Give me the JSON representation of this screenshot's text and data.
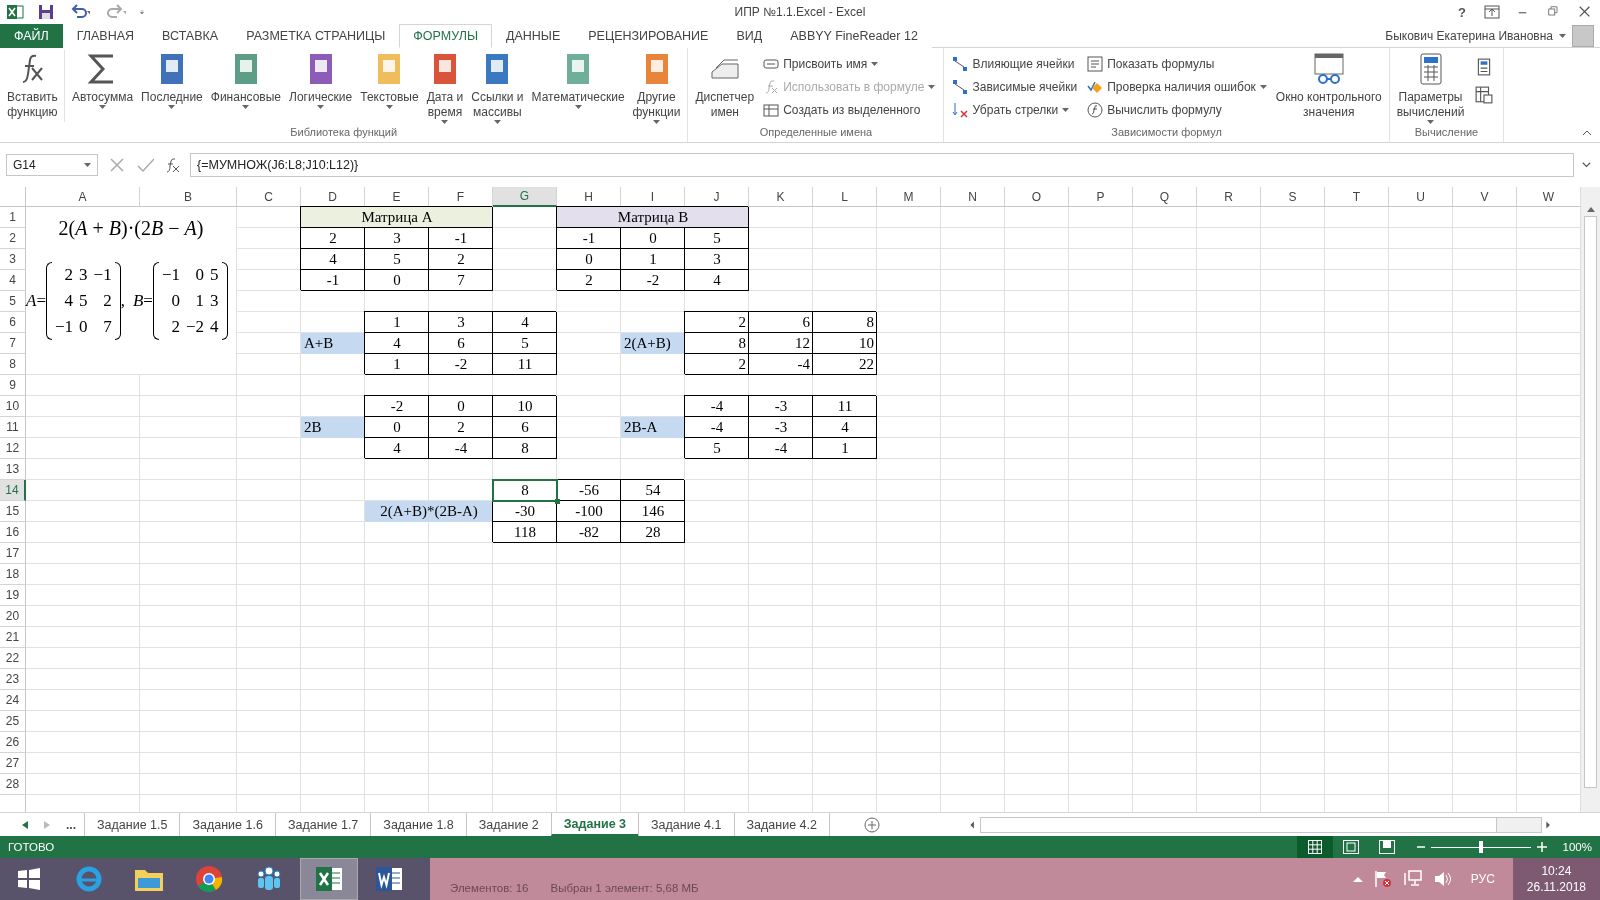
{
  "window": {
    "title": "ИПР №1.1.Excel - Excel",
    "help": "?"
  },
  "tabs": [
    {
      "label": "ФАЙЛ",
      "kind": "file",
      "selected": false
    },
    {
      "label": "ГЛАВНАЯ",
      "kind": "tab",
      "selected": false
    },
    {
      "label": "ВСТАВКА",
      "kind": "tab",
      "selected": false
    },
    {
      "label": "РАЗМЕТКА СТРАНИЦЫ",
      "kind": "tab",
      "selected": false
    },
    {
      "label": "ФОРМУЛЫ",
      "kind": "tab",
      "selected": true
    },
    {
      "label": "ДАННЫЕ",
      "kind": "tab",
      "selected": false
    },
    {
      "label": "РЕЦЕНЗИРОВАНИЕ",
      "kind": "tab",
      "selected": false
    },
    {
      "label": "ВИД",
      "kind": "tab",
      "selected": false
    },
    {
      "label": "ABBYY FineReader 12",
      "kind": "tab",
      "selected": false
    }
  ],
  "user": "Быкович Екатерина Ивановна",
  "ribbon": [
    {
      "label": "Библиотека функций",
      "items": [
        {
          "kind": "big",
          "lines": [
            "Вставить",
            "функцию"
          ],
          "menu": false
        },
        {
          "kind": "big",
          "lines": [
            "Автосумма"
          ],
          "menu": true
        },
        {
          "kind": "big",
          "lines": [
            "Последние"
          ],
          "menu": true
        },
        {
          "kind": "big",
          "lines": [
            "Финансовые"
          ],
          "menu": true
        },
        {
          "kind": "big",
          "lines": [
            "Логические"
          ],
          "menu": true
        },
        {
          "kind": "big",
          "lines": [
            "Текстовые"
          ],
          "menu": true
        },
        {
          "kind": "big",
          "lines": [
            "Дата и",
            "время"
          ],
          "menu": true
        },
        {
          "kind": "big",
          "lines": [
            "Ссылки и",
            "массивы"
          ],
          "menu": true
        },
        {
          "kind": "big",
          "lines": [
            "Математические"
          ],
          "menu": true
        },
        {
          "kind": "big",
          "lines": [
            "Другие",
            "функции"
          ],
          "menu": true
        }
      ]
    },
    {
      "label": "Определенные имена",
      "items": [
        {
          "kind": "big",
          "lines": [
            "Диспетчер",
            "имен"
          ],
          "menu": false
        },
        {
          "kind": "stack",
          "items": [
            {
              "label": "Присвоить имя",
              "menu": true,
              "disabled": false
            },
            {
              "label": "Использовать в формуле",
              "menu": true,
              "disabled": true
            },
            {
              "label": "Создать из выделенного",
              "menu": false,
              "disabled": false
            }
          ]
        }
      ]
    },
    {
      "label": "Зависимости формул",
      "items": [
        {
          "kind": "stack",
          "items": [
            {
              "label": "Влияющие ячейки",
              "menu": false,
              "disabled": false
            },
            {
              "label": "Зависимые ячейки",
              "menu": false,
              "disabled": false
            },
            {
              "label": "Убрать стрелки",
              "menu": true,
              "disabled": false
            }
          ]
        },
        {
          "kind": "stack",
          "items": [
            {
              "label": "Показать формулы",
              "menu": false,
              "disabled": false
            },
            {
              "label": "Проверка наличия ошибок",
              "menu": true,
              "disabled": false
            },
            {
              "label": "Вычислить формулу",
              "menu": false,
              "disabled": false
            }
          ]
        },
        {
          "kind": "big",
          "lines": [
            "Окно контрольного",
            "значения"
          ],
          "menu": false
        }
      ]
    },
    {
      "label": "Вычисление",
      "items": [
        {
          "kind": "big",
          "lines": [
            "Параметры",
            "вычислений"
          ],
          "menu": true
        },
        {
          "kind": "icons"
        }
      ]
    }
  ],
  "formula_bar": {
    "name_box": "G14",
    "formula": "{=МУМНОЖ(J6:L8;J10:L12)}"
  },
  "sheet": {
    "columns": [
      {
        "label": "A",
        "selected": false
      },
      {
        "label": "B",
        "selected": false
      },
      {
        "label": "C",
        "selected": false
      },
      {
        "label": "D",
        "selected": false
      },
      {
        "label": "E",
        "selected": false
      },
      {
        "label": "F",
        "selected": false
      },
      {
        "label": "G",
        "selected": true
      },
      {
        "label": "H",
        "selected": false
      },
      {
        "label": "I",
        "selected": false
      },
      {
        "label": "J",
        "selected": false
      },
      {
        "label": "K",
        "selected": false
      },
      {
        "label": "L",
        "selected": false
      },
      {
        "label": "M",
        "selected": false
      },
      {
        "label": "N",
        "selected": false
      },
      {
        "label": "O",
        "selected": false
      },
      {
        "label": "P",
        "selected": false
      },
      {
        "label": "Q",
        "selected": false
      },
      {
        "label": "R",
        "selected": false
      },
      {
        "label": "S",
        "selected": false
      },
      {
        "label": "T",
        "selected": false
      },
      {
        "label": "U",
        "selected": false
      },
      {
        "label": "V",
        "selected": false
      },
      {
        "label": "W",
        "selected": false
      }
    ],
    "rows": [
      {
        "label": "1",
        "selected": false,
        "cells": [
          "",
          "",
          "",
          {
            "value": "Матрица А",
            "kind": "title-a",
            "selected": false
          },
          "",
          "",
          "",
          {
            "value": "Матрица В",
            "kind": "title-b",
            "selected": false
          }
        ]
      },
      {
        "label": "2",
        "selected": false,
        "cells": [
          "",
          "",
          "",
          {
            "value": "2",
            "kind": "boxed",
            "selected": false
          },
          {
            "value": "3",
            "kind": "boxed",
            "selected": false
          },
          {
            "value": "-1",
            "kind": "boxed",
            "selected": false
          },
          "",
          {
            "value": "-1",
            "kind": "boxed",
            "selected": false
          },
          {
            "value": "0",
            "kind": "boxed",
            "selected": false
          },
          {
            "value": "5",
            "kind": "boxed",
            "selected": false
          }
        ]
      },
      {
        "label": "3",
        "selected": false,
        "cells": [
          "",
          "",
          "",
          {
            "value": "4",
            "kind": "boxed",
            "selected": false
          },
          {
            "value": "5",
            "kind": "boxed",
            "selected": false
          },
          {
            "value": "2",
            "kind": "boxed",
            "selected": false
          },
          "",
          {
            "value": "0",
            "kind": "boxed",
            "selected": false
          },
          {
            "value": "1",
            "kind": "boxed",
            "selected": false
          },
          {
            "value": "3",
            "kind": "boxed",
            "selected": false
          }
        ]
      },
      {
        "label": "4",
        "selected": false,
        "cells": [
          "",
          "",
          "",
          {
            "value": "-1",
            "kind": "boxed",
            "selected": false
          },
          {
            "value": "0",
            "kind": "boxed",
            "selected": false
          },
          {
            "value": "7",
            "kind": "boxed",
            "selected": false
          },
          "",
          {
            "value": "2",
            "kind": "boxed",
            "selected": false
          },
          {
            "value": "-2",
            "kind": "boxed",
            "selected": false
          },
          {
            "value": "4",
            "kind": "boxed",
            "selected": false
          }
        ]
      },
      {
        "label": "5",
        "selected": false
      },
      {
        "label": "6",
        "selected": false,
        "cells": [
          "",
          "",
          "",
          "",
          {
            "value": "1",
            "kind": "boxed",
            "selected": false
          },
          {
            "value": "3",
            "kind": "boxed",
            "selected": false
          },
          {
            "value": "4",
            "kind": "boxed",
            "selected": false
          },
          "",
          "",
          {
            "value": "2",
            "kind": "boxed-right",
            "selected": false
          },
          {
            "value": "6",
            "kind": "boxed-right",
            "selected": false
          },
          {
            "value": "8",
            "kind": "boxed-right",
            "selected": false
          }
        ]
      },
      {
        "label": "7",
        "selected": false,
        "cells": [
          "",
          "",
          "",
          {
            "value": "A+B",
            "kind": "label",
            "selected": false
          },
          {
            "value": "4",
            "kind": "boxed",
            "selected": false
          },
          {
            "value": "6",
            "kind": "boxed",
            "selected": false
          },
          {
            "value": "5",
            "kind": "boxed",
            "selected": false
          },
          "",
          {
            "value": "2(A+B)",
            "kind": "label",
            "selected": false
          },
          {
            "value": "8",
            "kind": "boxed-right",
            "selected": false
          },
          {
            "value": "12",
            "kind": "boxed-right",
            "selected": false
          },
          {
            "value": "10",
            "kind": "boxed-right",
            "selected": false
          }
        ]
      },
      {
        "label": "8",
        "selected": false,
        "cells": [
          "",
          "",
          "",
          "",
          {
            "value": "1",
            "kind": "boxed",
            "selected": false
          },
          {
            "value": "-2",
            "kind": "boxed",
            "selected": false
          },
          {
            "value": "11",
            "kind": "boxed",
            "selected": false
          },
          "",
          "",
          {
            "value": "2",
            "kind": "boxed-right",
            "selected": false
          },
          {
            "value": "-4",
            "kind": "boxed-right",
            "selected": false
          },
          {
            "value": "22",
            "kind": "boxed-right",
            "selected": false
          }
        ]
      },
      {
        "label": "9",
        "selected": false
      },
      {
        "label": "10",
        "selected": false,
        "cells": [
          "",
          "",
          "",
          "",
          {
            "value": "-2",
            "kind": "boxed",
            "selected": false
          },
          {
            "value": "0",
            "kind": "boxed",
            "selected": false
          },
          {
            "value": "10",
            "kind": "boxed",
            "selected": false
          },
          "",
          "",
          {
            "value": "-4",
            "kind": "boxed",
            "selected": false
          },
          {
            "value": "-3",
            "kind": "boxed",
            "selected": false
          },
          {
            "value": "11",
            "kind": "boxed",
            "selected": false
          }
        ]
      },
      {
        "label": "11",
        "selected": false,
        "cells": [
          "",
          "",
          "",
          {
            "value": "2B",
            "kind": "label",
            "selected": false
          },
          {
            "value": "0",
            "kind": "boxed",
            "selected": false
          },
          {
            "value": "2",
            "kind": "boxed",
            "selected": false
          },
          {
            "value": "6",
            "kind": "boxed",
            "selected": false
          },
          "",
          {
            "value": "2B-A",
            "kind": "label",
            "selected": false
          },
          {
            "value": "-4",
            "kind": "boxed",
            "selected": false
          },
          {
            "value": "-3",
            "kind": "boxed",
            "selected": false
          },
          {
            "value": "4",
            "kind": "boxed",
            "selected": false
          }
        ]
      },
      {
        "label": "12",
        "selected": false,
        "cells": [
          "",
          "",
          "",
          "",
          {
            "value": "4",
            "kind": "boxed",
            "selected": false
          },
          {
            "value": "-4",
            "kind": "boxed",
            "selected": false
          },
          {
            "value": "8",
            "kind": "boxed",
            "selected": false
          },
          "",
          "",
          {
            "value": "5",
            "kind": "boxed",
            "selected": false
          },
          {
            "value": "-4",
            "kind": "boxed",
            "selected": false
          },
          {
            "value": "1",
            "kind": "boxed",
            "selected": false
          }
        ]
      },
      {
        "label": "13",
        "selected": false
      },
      {
        "label": "14",
        "selected": true,
        "cells": [
          "",
          "",
          "",
          "",
          "",
          "",
          {
            "value": "8",
            "kind": "boxed",
            "selected": true
          },
          {
            "value": "-56",
            "kind": "boxed",
            "selected": false
          },
          {
            "value": "54",
            "kind": "boxed",
            "selected": false
          }
        ]
      },
      {
        "label": "15",
        "selected": false,
        "cells": [
          "",
          "",
          "",
          "",
          {
            "value": "2(A+B)*(2B-A)",
            "kind": "caption",
            "selected": false
          },
          "",
          {
            "value": "-30",
            "kind": "boxed",
            "selected": false
          },
          {
            "value": "-100",
            "kind": "boxed",
            "selected": false
          },
          {
            "value": "146",
            "kind": "boxed",
            "selected": false
          }
        ]
      },
      {
        "label": "16",
        "selected": false,
        "cells": [
          "",
          "",
          "",
          "",
          "",
          "",
          {
            "value": "118",
            "kind": "boxed",
            "selected": false
          },
          {
            "value": "-82",
            "kind": "boxed",
            "selected": false
          },
          {
            "value": "28",
            "kind": "boxed",
            "selected": false
          }
        ]
      },
      {
        "label": "17",
        "selected": false
      },
      {
        "label": "18",
        "selected": false
      },
      {
        "label": "19",
        "selected": false
      },
      {
        "label": "20",
        "selected": false
      },
      {
        "label": "21",
        "selected": false
      },
      {
        "label": "22",
        "selected": false
      },
      {
        "label": "23",
        "selected": false
      },
      {
        "label": "24",
        "selected": false
      },
      {
        "label": "25",
        "selected": false
      },
      {
        "label": "26",
        "selected": false
      },
      {
        "label": "27",
        "selected": false
      },
      {
        "label": "28",
        "selected": false
      }
    ],
    "equation": {
      "expression": [
        "2(",
        "A",
        " + ",
        "B",
        ")·(2",
        "B",
        " − ",
        "A",
        ")"
      ],
      "matrices": [
        {
          "name": "*A*=",
          "rows": [
            [
              "2",
              "3",
              "−1"
            ],
            [
              "4",
              "5",
              "2"
            ],
            [
              "−1",
              "0",
              "7"
            ]
          ],
          "after": ","
        },
        {
          "name": "*B*=",
          "rows": [
            [
              "−1",
              "0",
              "5"
            ],
            [
              "0",
              "1",
              "3"
            ],
            [
              "2",
              "−2",
              "4"
            ]
          ]
        }
      ]
    }
  },
  "sheet_tabs": {
    "more": "...",
    "tabs": [
      {
        "label": "Задание 1.5",
        "selected": false
      },
      {
        "label": "Задание 1.6",
        "selected": false
      },
      {
        "label": "Задание 1.7",
        "selected": false
      },
      {
        "label": "Задание 1.8",
        "selected": false
      },
      {
        "label": "Задание 2",
        "selected": false
      },
      {
        "label": "Задание 3",
        "selected": true
      },
      {
        "label": "Задание 4.1",
        "selected": false
      },
      {
        "label": "Задание 4.2",
        "selected": false
      }
    ]
  },
  "status_bar": {
    "status": "ГОТОВО",
    "views": [
      {
        "selected": true
      },
      {
        "selected": false
      },
      {
        "selected": false
      }
    ],
    "zoom": {
      "level": 0.5,
      "reading": "100%"
    }
  },
  "taskbar": {
    "apps": [
      {
        "selected": false
      },
      {
        "selected": false
      },
      {
        "selected": false
      },
      {
        "selected": false
      },
      {
        "selected": true
      },
      {
        "selected": false
      }
    ],
    "explorer_status": [
      "Элементов: 16",
      "Выбран 1 элемент: 5,68 МБ"
    ],
    "language": "РУС",
    "time": "10:24",
    "date": "26.11.2018"
  }
}
